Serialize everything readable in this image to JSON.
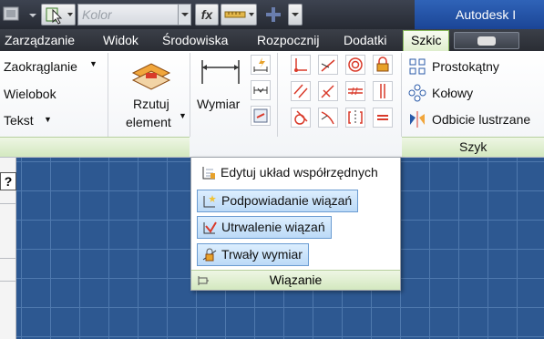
{
  "titlebar": {
    "color_field": "Kolor",
    "fx_label": "fx",
    "app_title": "Autodesk I"
  },
  "tabs": [
    "Zarządzanie",
    "Widok",
    "Środowiska",
    "Rozpocznij",
    "Dodatki",
    "Szkic"
  ],
  "active_tab": "Szkic",
  "ribbon": {
    "draw": {
      "items": [
        "Zaokrąglanie",
        "Wielobok",
        "Tekst"
      ]
    },
    "project": {
      "label_line1": "Rzutuj",
      "label_line2": "element"
    },
    "constraint": {
      "dimension_label": "Wymiar"
    },
    "pattern": {
      "items": [
        "Prostokątny",
        "Kołowy",
        "Odbicie lustrzane"
      ],
      "footer": "Szyk"
    }
  },
  "dropdown": {
    "items": [
      {
        "label": "Edytuj układ współrzędnych",
        "selected": false
      },
      {
        "label": "Podpowiadanie wiązań",
        "selected": true
      },
      {
        "label": "Utrwalenie wiązań",
        "selected": true
      },
      {
        "label": "Trwały wymiar",
        "selected": true
      }
    ],
    "footer": "Wiązanie"
  },
  "colors": {
    "canvas": "#2d5891",
    "grid": "#4f79ae",
    "selection": "#bcdaf7",
    "panel_footer": "#d3e8bf"
  }
}
